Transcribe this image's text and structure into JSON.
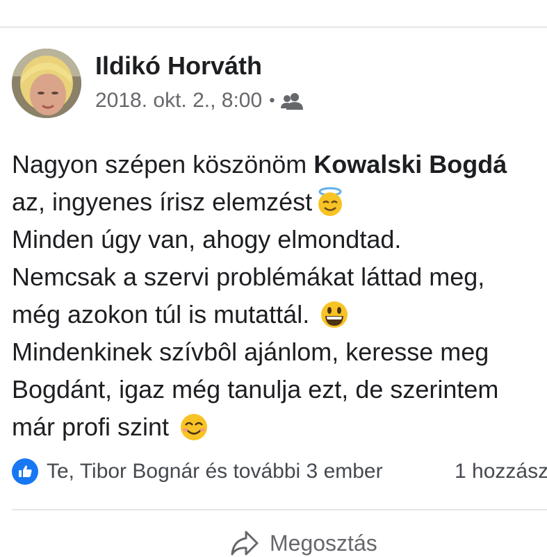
{
  "post": {
    "author": "Ildikó Horváth",
    "timestamp": "2018. okt. 2., 8:00",
    "separator": "•",
    "audience_icon": "friends-icon",
    "body": {
      "line1_text": "Nagyon szépen köszönöm ",
      "line1_mention": "Kowalski Bogdá",
      "line2_text": "az, ingyenes írisz elemzést",
      "line2_emoji": "smiling-face-with-halo",
      "line3_text": "Minden úgy van, ahogy elmondtad.",
      "line4_text": "Nemcsak a szervi problémákat láttad meg,",
      "line5_text": "még azokon túl is mutattál. ",
      "line5_emoji": "grinning-face",
      "line6_text": "Mindenkinek szívbôl ajánlom, keresse meg",
      "line7_text": "Bogdánt, igaz még tanulja ezt, de szerintem",
      "line8_text": "már profi szint ",
      "line8_emoji": "smiling-face-with-smiling-eyes"
    }
  },
  "reactions": {
    "icon": "like-icon",
    "text": "Te, Tibor Bognár és további 3 ember",
    "comments": "1 hozzász"
  },
  "actions": {
    "share_label": "Megosztás",
    "share_icon": "share-icon"
  },
  "colors": {
    "like_blue": "#1877f2",
    "meta_gray": "#65676b",
    "text": "#1c1e21",
    "emoji_yellow": "#f7c325"
  }
}
